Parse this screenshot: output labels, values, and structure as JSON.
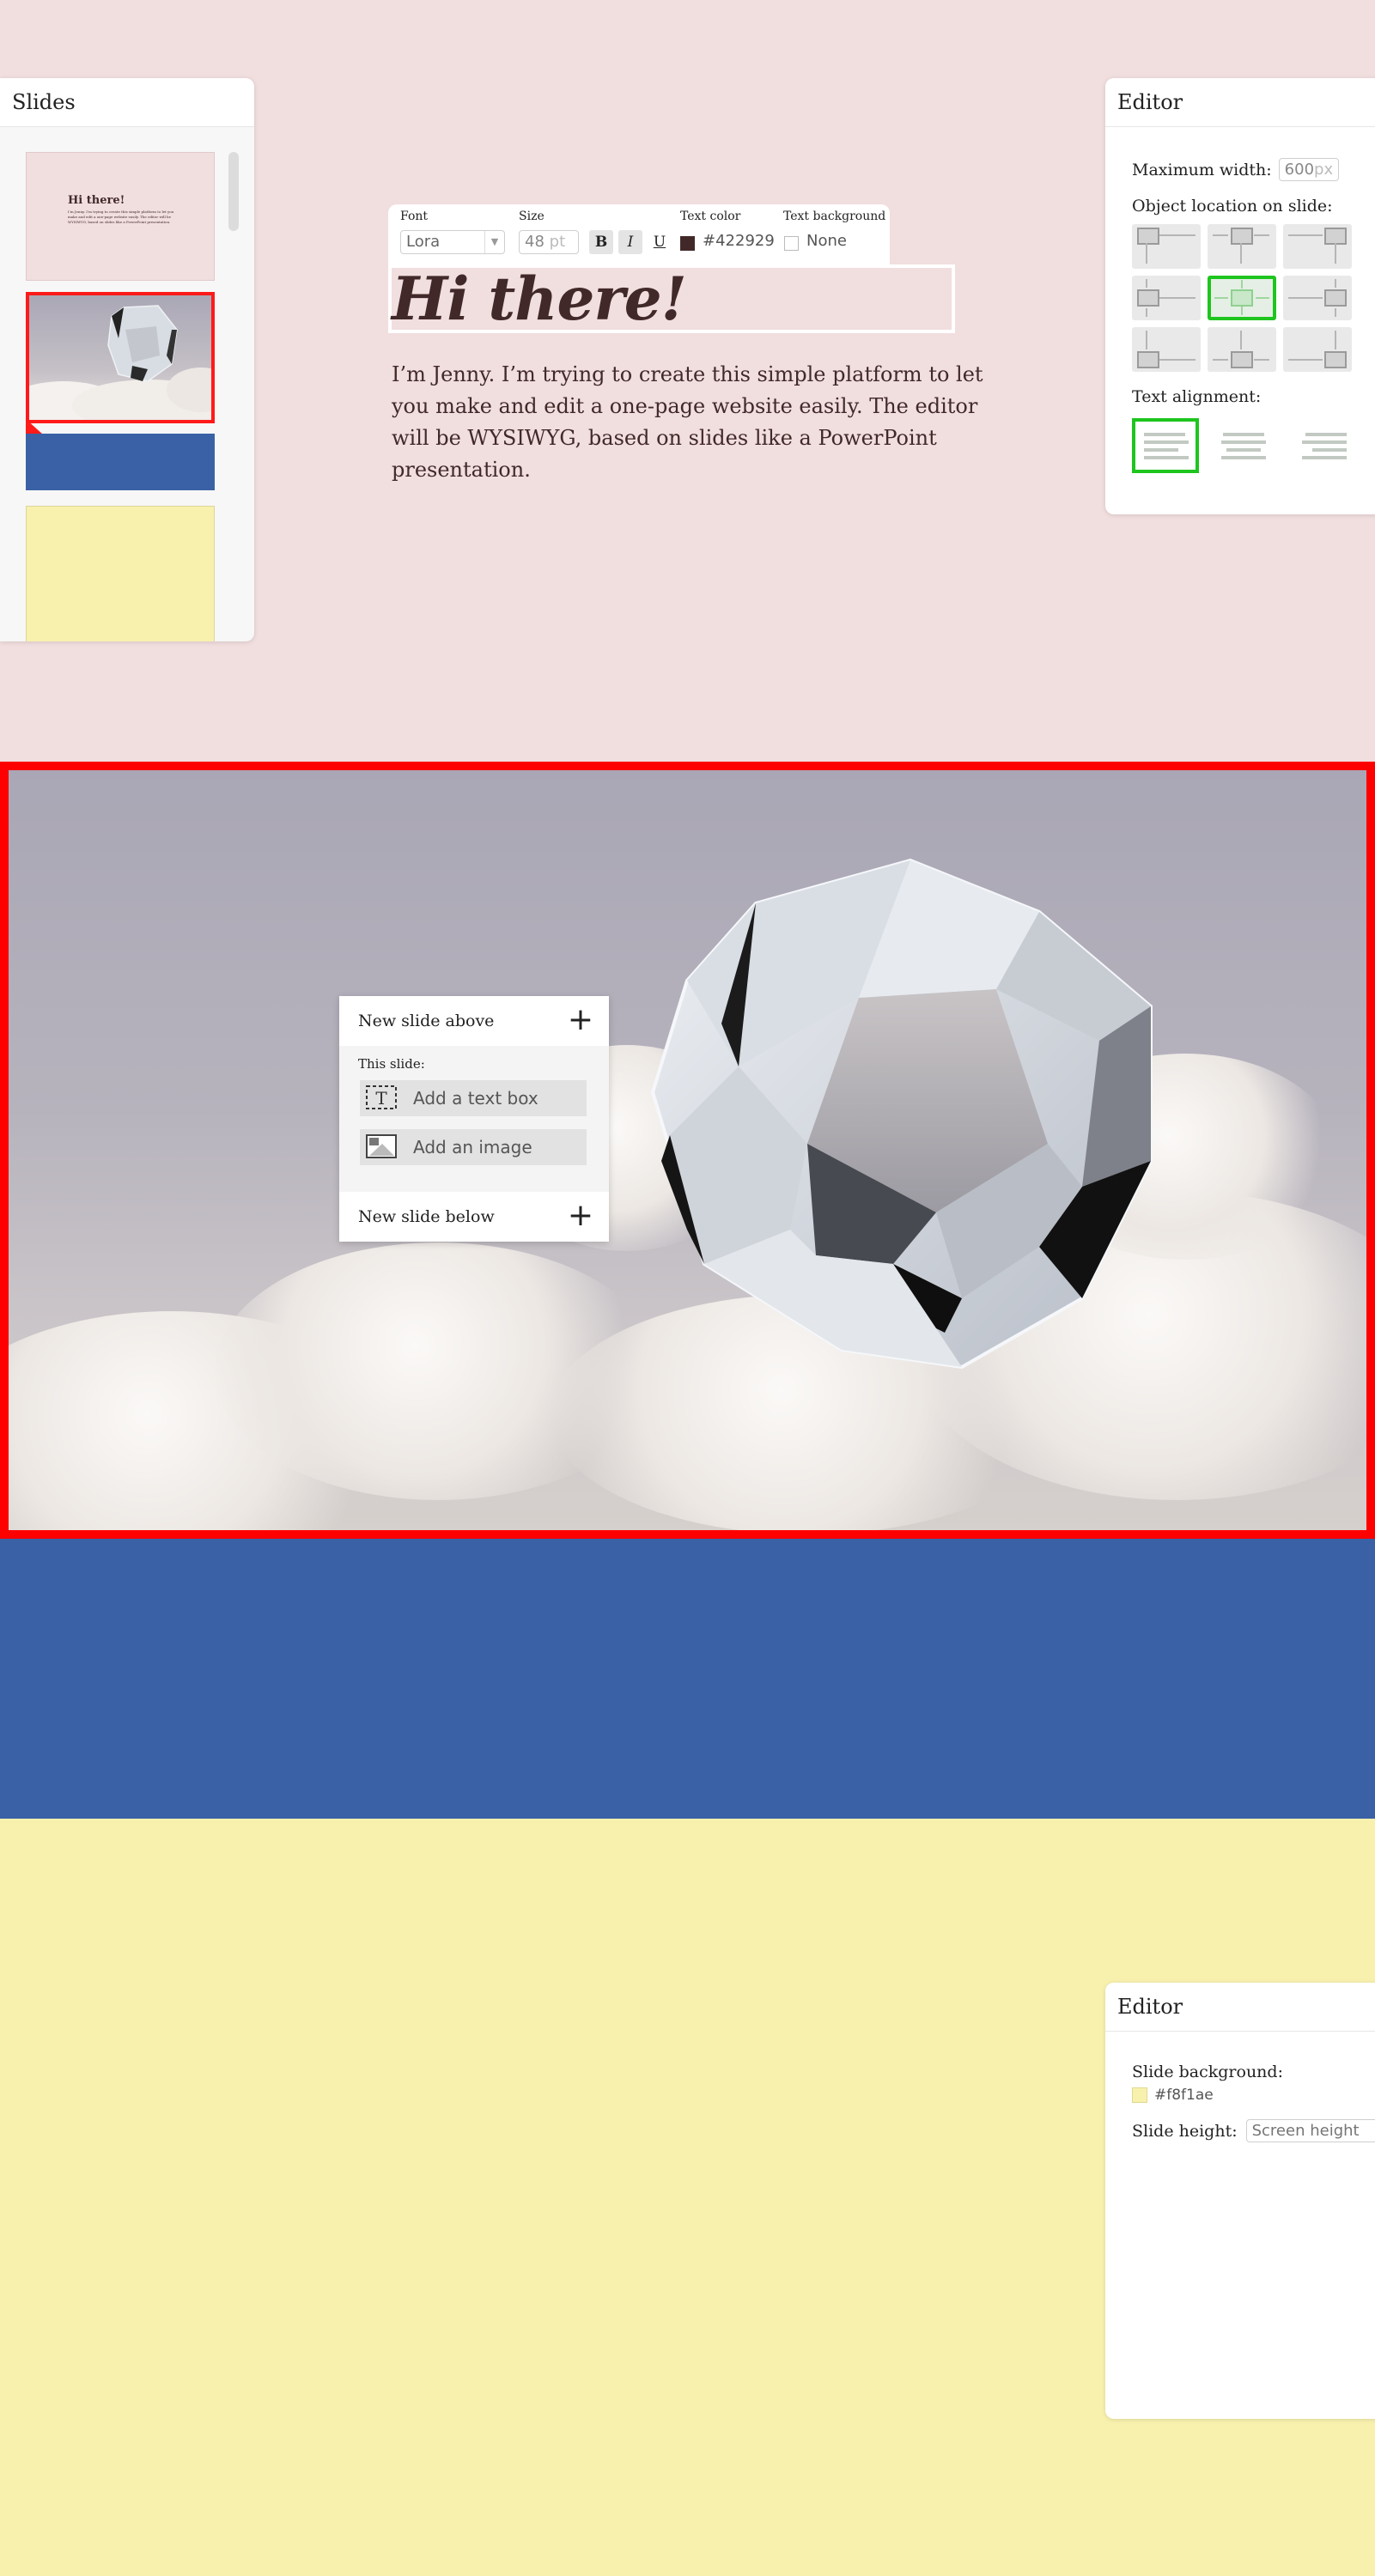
{
  "slides_panel": {
    "title": "Slides",
    "thumb_1": {
      "heading": "Hi there!",
      "body": "I’m Jenny. I’m trying to create this simple platform to let you make and edit a one-page website easily. The editor will be WYSIWYG, based on slides like a PowerPoint presentation."
    }
  },
  "slide_1": {
    "background": "#f1dede",
    "heading": "Hi there!",
    "intro": "I’m Jenny. I’m trying to create this simple platform to let you make and edit a one-page website easily. The editor will be WYSIWYG, based on slides like a PowerPoint presentation."
  },
  "toolbar": {
    "font_label": "Font",
    "font_value": "Lora",
    "size_label": "Size",
    "size_value": "48",
    "size_unit": "pt",
    "bold": "B",
    "italic": "I",
    "underline": "U",
    "text_color_label": "Text color",
    "text_color_value": "#422929",
    "text_bg_label": "Text background",
    "text_bg_value": "None"
  },
  "editor_1": {
    "title": "Editor",
    "max_width_label": "Maximum width:",
    "max_width_value": "600",
    "max_width_unit": "px",
    "location_label": "Object location on slide:",
    "location_selected": "center",
    "alignment_label": "Text alignment:",
    "alignment_selected": "left"
  },
  "context_menu": {
    "new_above": "New slide above",
    "this_slide": "This slide:",
    "add_text": "Add a text box",
    "add_image": "Add an image",
    "new_below": "New slide below",
    "plus": "+",
    "text_icon_glyph": "T"
  },
  "editor_2": {
    "title": "Editor",
    "bg_label": "Slide background:",
    "bg_value": "#f8f1ae",
    "height_label": "Slide height:",
    "height_placeholder": "Screen height"
  },
  "colors": {
    "accent_selection": "#ff0000",
    "valid_selection": "#1ec51e",
    "slide_3": "#3a61a6",
    "slide_4": "#f8f1ae"
  },
  "icons": [
    "plus-icon",
    "text-box-icon",
    "image-icon",
    "dropdown-arrow-icon",
    "mouse-cursor-icon",
    "image-placeholder-icon"
  ]
}
